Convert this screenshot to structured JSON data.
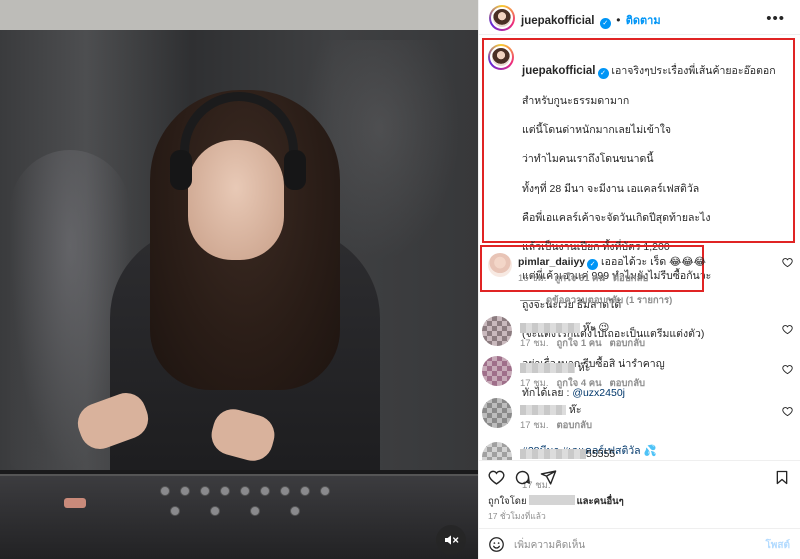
{
  "post": {
    "username": "juepakofficial",
    "follow_label": "ติดตาม",
    "separator": "•",
    "more_icon": "more-horizontal-icon"
  },
  "caption": {
    "username": "juepakofficial",
    "lines": [
      "เอาจริงๆประเรื่องพี่เส้นค้ายอะอ๊อตอก",
      "สำหรับกูนะธรรมดามาก",
      "แต่นี้โดนด่าหนักมากเลยไม่เข้าใจ",
      "ว่าทำไมคนเราถึงโดนขนาดนี้",
      "ทั้งๆที่ 28 มีนา จะมีงาน เอแคลร์เฟสติวัล",
      "คือพี่เอแคลร์เค้าจะจัดวันเกิดปีสุดท้ายละไง",
      "แล้วเป็นงานเปียก ทั้งที่บัตร 1,200",
      "แต่พี่เค้าเอาแค่ 999 ทำไมยังไม่รีบซื้อกันวะ",
      "ถูงจะนะเวย ธีมลาดได้",
      "(จะแต่งไรก็แต่งไปเถอะเป็นแตรีมแต่งตัว)",
      "อย่าเรื่องมาก รีบซื้อสิ น่ารำคาญ"
    ],
    "tag_prefix": "ทักได้เลย : ",
    "tag_mention": "@uzx2450j",
    "hashtags": "#28มีนา #เอแคลร์เฟสติวัล 💦",
    "time": "17 ชม."
  },
  "highlighted_comment": {
    "username": "pimlar_daiiyy",
    "text": "เอออได้วะ เร็ด 😂😂😂",
    "time": "16 ชม.",
    "likes": "ถูกใจ 61 คน",
    "reply": "ตอบกลับ",
    "view_replies": "ดูข้อความตอบกลับ (1 รายการ)"
  },
  "comments": [
    {
      "text_suffix": "ห๊ะ 😉",
      "time": "17 ชม.",
      "likes": "ถูกใจ 1 คน",
      "reply": "ตอบกลับ"
    },
    {
      "text_suffix": "ห๊ะ",
      "time": "17 ชม.",
      "likes": "ถูกใจ 4 คน",
      "reply": "ตอบกลับ"
    },
    {
      "text_suffix": "ห๊ะ",
      "time": "17 ชม.",
      "likes": "",
      "reply": "ตอบกลับ"
    },
    {
      "text_suffix": "55555",
      "time": "",
      "likes": "",
      "reply": ""
    }
  ],
  "actions": {
    "like_icon": "heart-icon",
    "comment_icon": "comment-icon",
    "share_icon": "share-icon",
    "save_icon": "bookmark-icon"
  },
  "likes_line": {
    "prefix": "ถูกใจโดย",
    "suffix": "และคนอื่นๆ"
  },
  "post_time": "17 ชั่วโมงที่แล้ว",
  "add_comment": {
    "placeholder": "เพิ่มความคิดเห็น",
    "post_label": "โพสต์",
    "emoji_icon": "emoji-icon"
  },
  "media": {
    "mute_icon": "speaker-muted-icon"
  },
  "colors": {
    "accent": "#0095f6",
    "highlight_border": "#e02424",
    "link": "#00376b"
  }
}
